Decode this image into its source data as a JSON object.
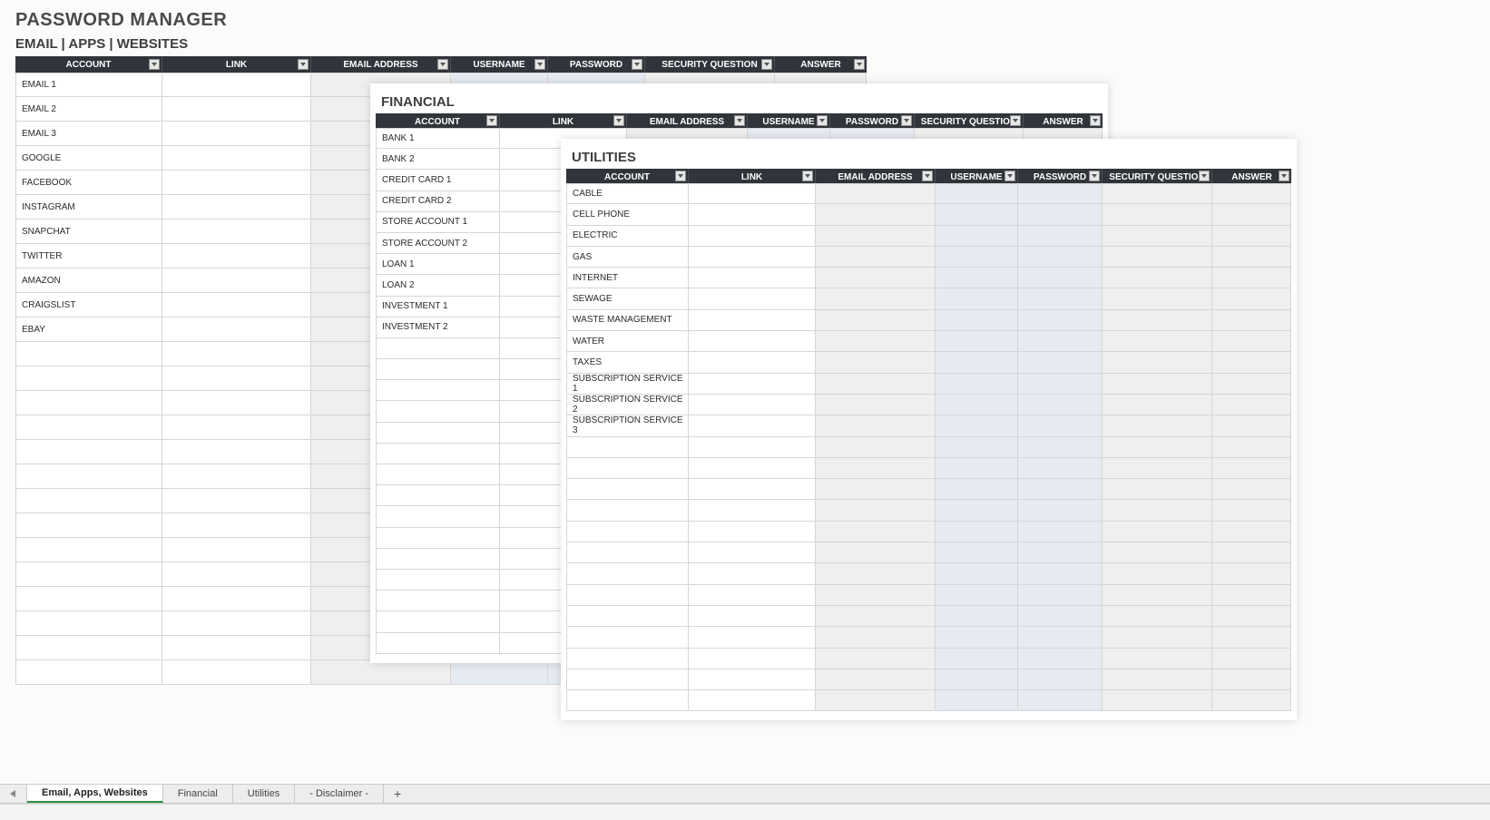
{
  "title": "PASSWORD MANAGER",
  "subtitle_main": "EMAIL | APPS | WEBSITES",
  "columns": [
    "ACCOUNT",
    "LINK",
    "EMAIL ADDRESS",
    "USERNAME",
    "PASSWORD",
    "SECURITY QUESTION",
    "ANSWER"
  ],
  "email_apps_websites": {
    "rows": [
      "EMAIL 1",
      "EMAIL 2",
      "EMAIL 3",
      "GOOGLE",
      "FACEBOOK",
      "INSTAGRAM",
      "SNAPCHAT",
      "TWITTER",
      "AMAZON",
      "CRAIGSLIST",
      "EBAY"
    ],
    "blank_rows": 14
  },
  "financial": {
    "title": "FINANCIAL",
    "rows": [
      "BANK 1",
      "BANK 2",
      "CREDIT CARD 1",
      "CREDIT CARD 2",
      "STORE ACCOUNT 1",
      "STORE ACCOUNT 2",
      "LOAN 1",
      "LOAN 2",
      "INVESTMENT 1",
      "INVESTMENT 2"
    ],
    "blank_rows": 15
  },
  "utilities": {
    "title": "UTILITIES",
    "rows": [
      "CABLE",
      "CELL PHONE",
      "ELECTRIC",
      "GAS",
      "INTERNET",
      "SEWAGE",
      "WASTE MANAGEMENT",
      "WATER",
      "TAXES",
      "SUBSCRIPTION SERVICE 1",
      "SUBSCRIPTION SERVICE 2",
      "SUBSCRIPTION SERVICE 3"
    ],
    "blank_rows": 13
  },
  "tabs": {
    "items": [
      "Email, Apps, Websites",
      "Financial",
      "Utilities",
      "- Disclaimer -"
    ],
    "active_index": 0,
    "add_label": "+"
  }
}
